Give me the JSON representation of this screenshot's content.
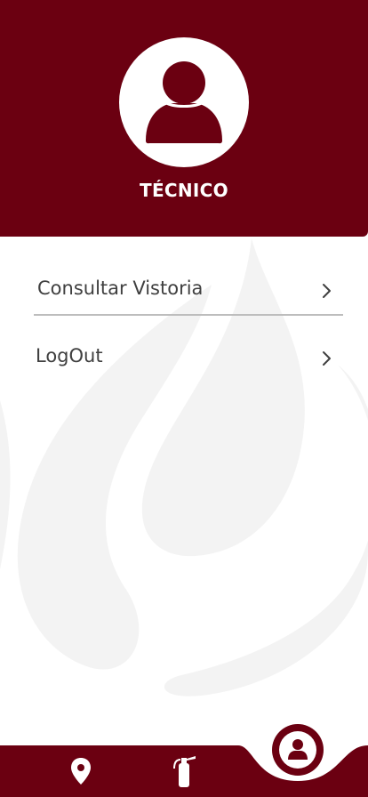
{
  "header": {
    "role": "TÉCNICO"
  },
  "menu": {
    "items": [
      {
        "label": "Consultar Vistoria"
      },
      {
        "label": "LogOut"
      }
    ]
  },
  "bottom_nav": {
    "items": [
      {
        "icon": "map-pin-icon"
      },
      {
        "icon": "fire-extinguisher-icon"
      },
      {
        "icon": "profile-icon",
        "active": true
      }
    ]
  },
  "colors": {
    "primary": "#6b0011",
    "background": "#ffffff",
    "text": "#3f3f3f",
    "divider": "#bdbdbd",
    "watermark": "#f2f2f2"
  }
}
